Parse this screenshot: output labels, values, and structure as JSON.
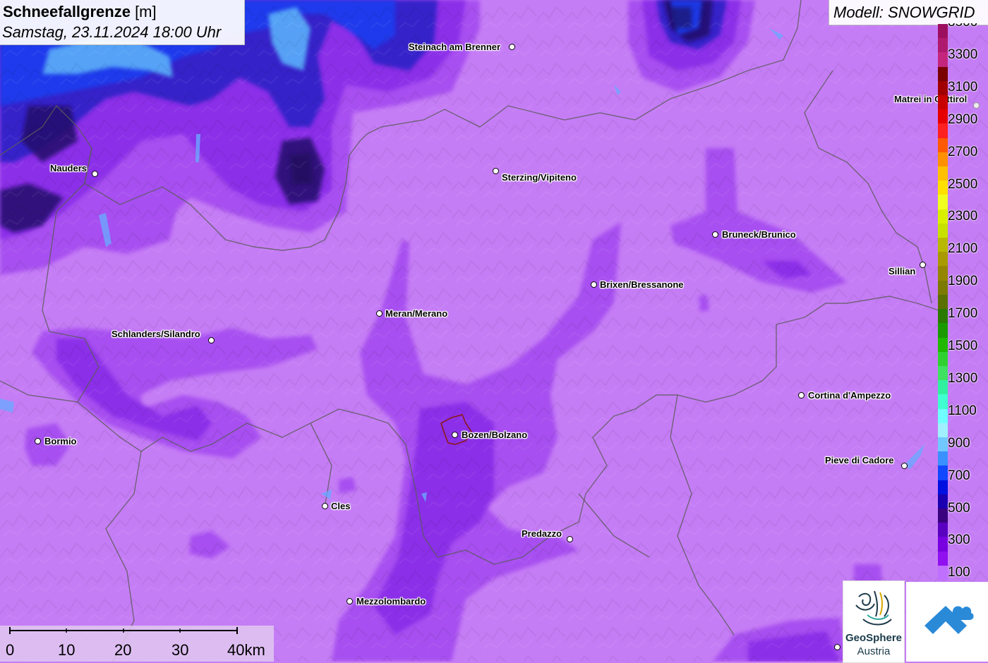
{
  "title": {
    "bold": "Schneefallgrenze",
    "unit": " [m]",
    "date": "Samstag, 23.11.2024 18:00 Uhr"
  },
  "model": {
    "label": "Modell: SNOWGRID"
  },
  "cities": [
    {
      "id": "steinach",
      "name": "Steinach am Brenner"
    },
    {
      "id": "matrei",
      "name": "Matrei in Osttirol"
    },
    {
      "id": "nauders",
      "name": "Nauders"
    },
    {
      "id": "sterzing",
      "name": "Sterzing/Vipiteno"
    },
    {
      "id": "bruneck",
      "name": "Bruneck/Brunico"
    },
    {
      "id": "sillian",
      "name": "Sillian"
    },
    {
      "id": "brixen",
      "name": "Brixen/Bressanone"
    },
    {
      "id": "meran",
      "name": "Meran/Merano"
    },
    {
      "id": "schlanders",
      "name": "Schlanders/Silandro"
    },
    {
      "id": "cortina",
      "name": "Cortina d'Ampezzo"
    },
    {
      "id": "bozen",
      "name": "Bozen/Bolzano"
    },
    {
      "id": "bormio",
      "name": "Bormio"
    },
    {
      "id": "pieve",
      "name": "Pieve di Cadore"
    },
    {
      "id": "cles",
      "name": "Cles"
    },
    {
      "id": "predazzo",
      "name": "Predazzo"
    },
    {
      "id": "mezzolombardo",
      "name": "Mezzolombardo"
    }
  ],
  "legend": {
    "labels": [
      "3500",
      "3300",
      "3100",
      "2900",
      "2700",
      "2500",
      "2300",
      "2100",
      "1900",
      "1700",
      "1500",
      "1300",
      "1100",
      "900",
      "700",
      "500",
      "300",
      "100"
    ],
    "colors": [
      "#9c0f5f",
      "#b01a6e",
      "#c4257d",
      "#7a0000",
      "#a00000",
      "#c80000",
      "#e60000",
      "#ff2020",
      "#ff5a00",
      "#ff9000",
      "#ffc000",
      "#ffe000",
      "#f0ff20",
      "#d8f000",
      "#c8e000",
      "#b8b800",
      "#a89a00",
      "#948600",
      "#7c7a00",
      "#5a7000",
      "#2a7a00",
      "#1a9a00",
      "#20b800",
      "#30d030",
      "#40e060",
      "#30f0a0",
      "#40ffd0",
      "#70ffff",
      "#a0f0ff",
      "#70c8ff",
      "#3a90ff",
      "#1048ff",
      "#0010e0",
      "#1a00b0",
      "#3a0080",
      "#5a00c0",
      "#7800e0",
      "#9010f0",
      "#c070ff"
    ]
  },
  "scale": {
    "labels": [
      "0",
      "10",
      "20",
      "30",
      "40km"
    ]
  },
  "logos": {
    "geosphere_line1": "GeoSphere",
    "geosphere_line2": "Austria"
  }
}
